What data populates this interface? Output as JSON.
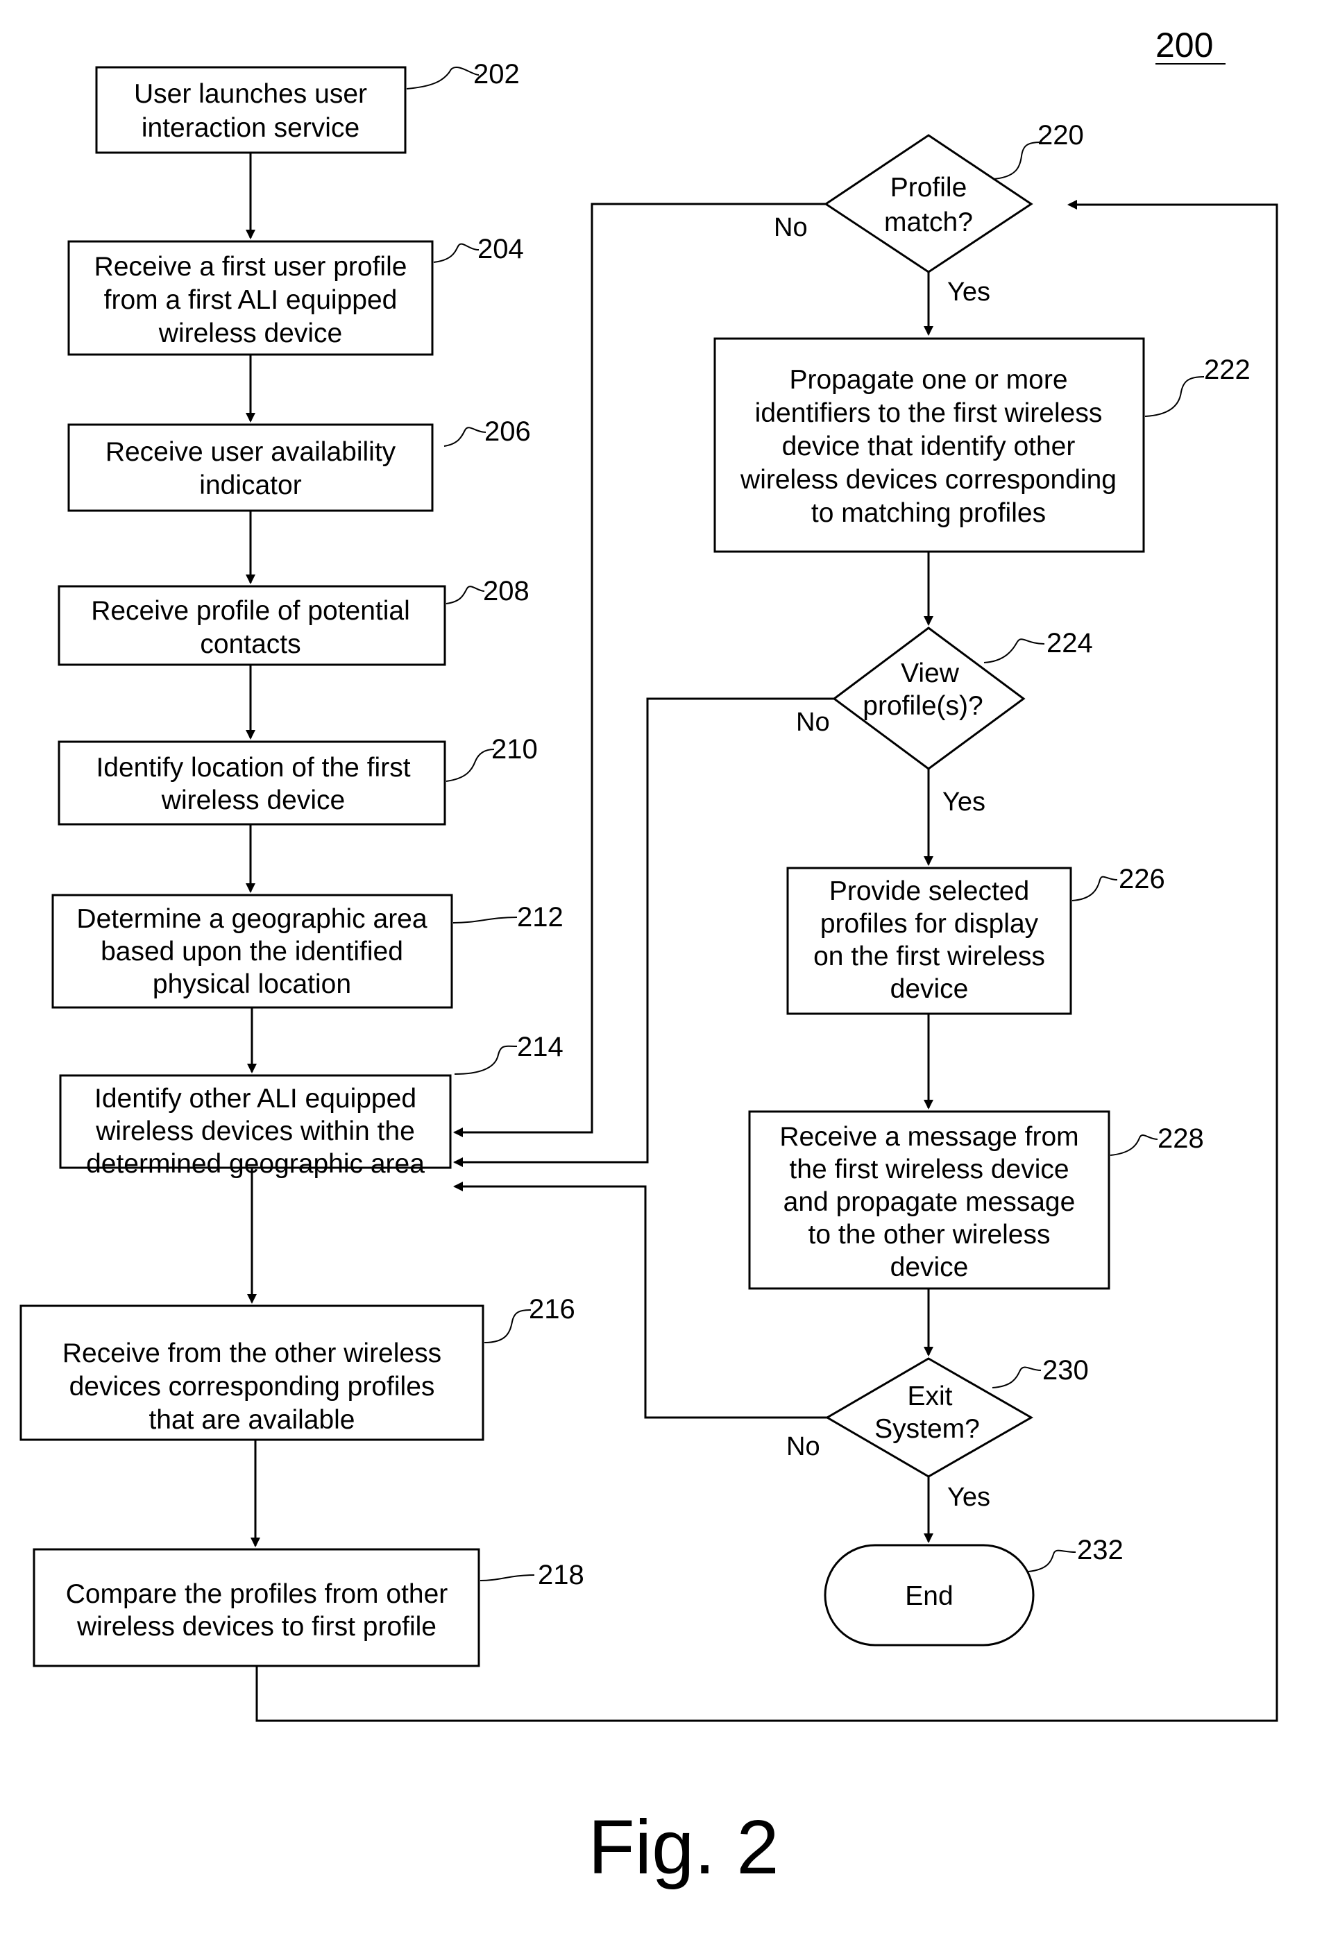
{
  "diagram_number": "200",
  "figure_caption": "Fig. 2",
  "nodes": {
    "n202": {
      "ref": "202",
      "lines": [
        "User launches user",
        "interaction service"
      ]
    },
    "n204": {
      "ref": "204",
      "lines": [
        "Receive a first user profile",
        "from a first ALI equipped",
        "wireless device"
      ]
    },
    "n206": {
      "ref": "206",
      "lines": [
        "Receive user availability",
        "indicator"
      ]
    },
    "n208": {
      "ref": "208",
      "lines": [
        "Receive profile of potential",
        "contacts"
      ]
    },
    "n210": {
      "ref": "210",
      "lines": [
        "Identify location of the first",
        "wireless device"
      ]
    },
    "n212": {
      "ref": "212",
      "lines": [
        "Determine a geographic area",
        "based upon the identified",
        "physical location"
      ]
    },
    "n214": {
      "ref": "214",
      "lines": [
        "Identify other ALI equipped",
        "wireless devices within the",
        "determined geographic area"
      ]
    },
    "n216": {
      "ref": "216",
      "lines": [
        "Receive from the other wireless",
        "devices corresponding profiles",
        "that are available"
      ]
    },
    "n218": {
      "ref": "218",
      "lines": [
        "Compare the profiles from other",
        "wireless devices to first profile"
      ]
    },
    "n220": {
      "ref": "220",
      "lines": [
        "Profile",
        "match?"
      ]
    },
    "n222": {
      "ref": "222",
      "lines": [
        "Propagate one or more",
        "identifiers to the first wireless",
        "device that identify other",
        "wireless devices corresponding",
        "to matching profiles"
      ]
    },
    "n224": {
      "ref": "224",
      "lines": [
        "View",
        "profile(s)?"
      ]
    },
    "n226": {
      "ref": "226",
      "lines": [
        "Provide selected",
        "profiles for display",
        "on the first wireless",
        "device"
      ]
    },
    "n228": {
      "ref": "228",
      "lines": [
        "Receive a message from",
        "the first wireless device",
        "and propagate message",
        "to the other wireless",
        "device"
      ]
    },
    "n230": {
      "ref": "230",
      "lines": [
        "Exit",
        "System?"
      ]
    },
    "n232": {
      "ref": "232",
      "lines": [
        "End"
      ]
    }
  },
  "edge_labels": {
    "d220_no": "No",
    "d220_yes": "Yes",
    "d224_no": "No",
    "d224_yes": "Yes",
    "d230_no": "No",
    "d230_yes": "Yes"
  }
}
